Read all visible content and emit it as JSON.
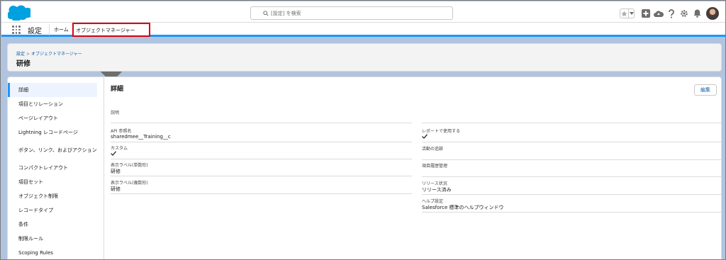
{
  "header": {
    "search_placeholder": "[設定] を検索",
    "icons": [
      "salesforce-logo",
      "search-icon",
      "favorite-star-icon",
      "chevron-down-icon",
      "global-actions-icon",
      "trailhead-cloud-icon",
      "help-icon",
      "setup-gear-icon",
      "notification-bell-icon",
      "user-avatar"
    ]
  },
  "nav": {
    "app_name": "設定",
    "home_label": "ホーム",
    "object_manager_label": "オブジェクトマネージャー"
  },
  "page": {
    "breadcrumb_setup": "設定",
    "breadcrumb_sep": ">",
    "breadcrumb_object_manager": "オブジェクトマネージャー",
    "title": "研修"
  },
  "sidebar": {
    "items": [
      {
        "label": "詳細"
      },
      {
        "label": "項目とリレーション"
      },
      {
        "label": "ページレイアウト"
      },
      {
        "label": "Lightning レコードページ"
      },
      {
        "label": "ボタン、リンク、およびアクション"
      },
      {
        "label": "コンパクトレイアウト"
      },
      {
        "label": "項目セット"
      },
      {
        "label": "オブジェクト制限"
      },
      {
        "label": "レコードタイプ"
      },
      {
        "label": "条件"
      },
      {
        "label": "制限ルール"
      },
      {
        "label": "Scoping Rules"
      }
    ]
  },
  "detail": {
    "heading": "詳細",
    "edit_button": "編集",
    "left_fields": [
      {
        "label": "説明",
        "value": ""
      },
      {
        "label": "API 参照名",
        "value": "sharedmee__Training__c"
      },
      {
        "label": "カスタム",
        "value": "checked"
      },
      {
        "label": "表示ラベル(単数形)",
        "value": "研修"
      },
      {
        "label": "表示ラベル(複数形)",
        "value": "研修"
      }
    ],
    "right_fields": [
      {
        "label": "",
        "value": ""
      },
      {
        "label": "レポートで使用する",
        "value": "checked"
      },
      {
        "label": "活動の追跡",
        "value": ""
      },
      {
        "label": "項目履歴管理",
        "value": ""
      },
      {
        "label": "リリース状況",
        "value": "リリース済み"
      },
      {
        "label": "ヘルプ設定",
        "value": "Salesforce 標準のヘルプウィンドウ"
      }
    ]
  },
  "colors": {
    "brand_blue": "#1b96ff",
    "link_blue": "#0b5cab",
    "highlight_red": "#d8000c",
    "background": "#b0c4df"
  }
}
